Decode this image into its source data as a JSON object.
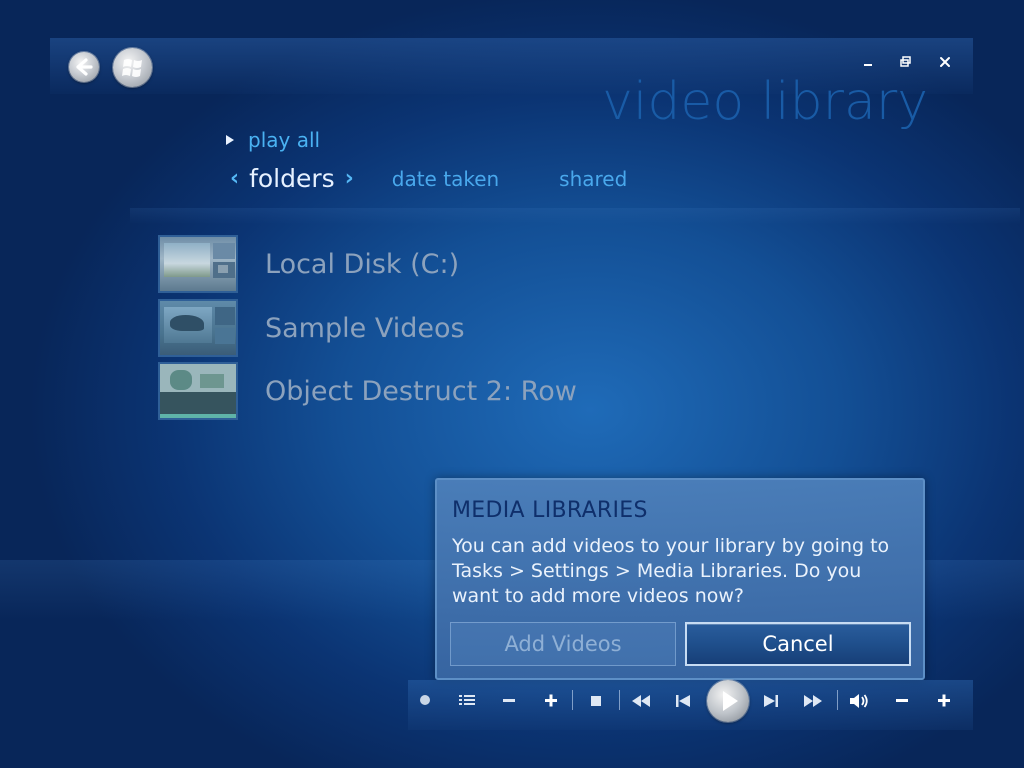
{
  "header": {
    "title": "video library",
    "back_icon": "back-arrow-icon",
    "start_icon": "windows-logo-icon",
    "window_controls": [
      "minimize-icon",
      "restore-icon",
      "close-icon"
    ]
  },
  "nav": {
    "play_all": "play all",
    "tabs": [
      {
        "label": "folders",
        "active": true
      },
      {
        "label": "date taken",
        "active": false
      },
      {
        "label": "shared",
        "active": false
      }
    ]
  },
  "items": [
    {
      "label": "Local Disk (C:)"
    },
    {
      "label": "Sample Videos"
    },
    {
      "label": "Object Destruct 2:   Row"
    }
  ],
  "dialog": {
    "title": "MEDIA LIBRARIES",
    "message": "You can add videos to your library by going to Tasks > Settings > Media Libraries. Do you want to add more videos now?",
    "primary_label": "Add Videos",
    "secondary_label": "Cancel"
  },
  "transport": {
    "buttons": [
      "record-icon",
      "list-icon",
      "minus-icon",
      "plus-icon",
      "stop-icon",
      "rewind-icon",
      "previous-icon",
      "play-icon",
      "next-icon",
      "fast-forward-icon",
      "volume-icon",
      "volume-down-icon",
      "volume-up-icon"
    ]
  },
  "colors": {
    "accent": "#4ab2f2",
    "title": "#1a5ea9",
    "dialog_title": "#0f2f6b",
    "background": "#134f95"
  }
}
